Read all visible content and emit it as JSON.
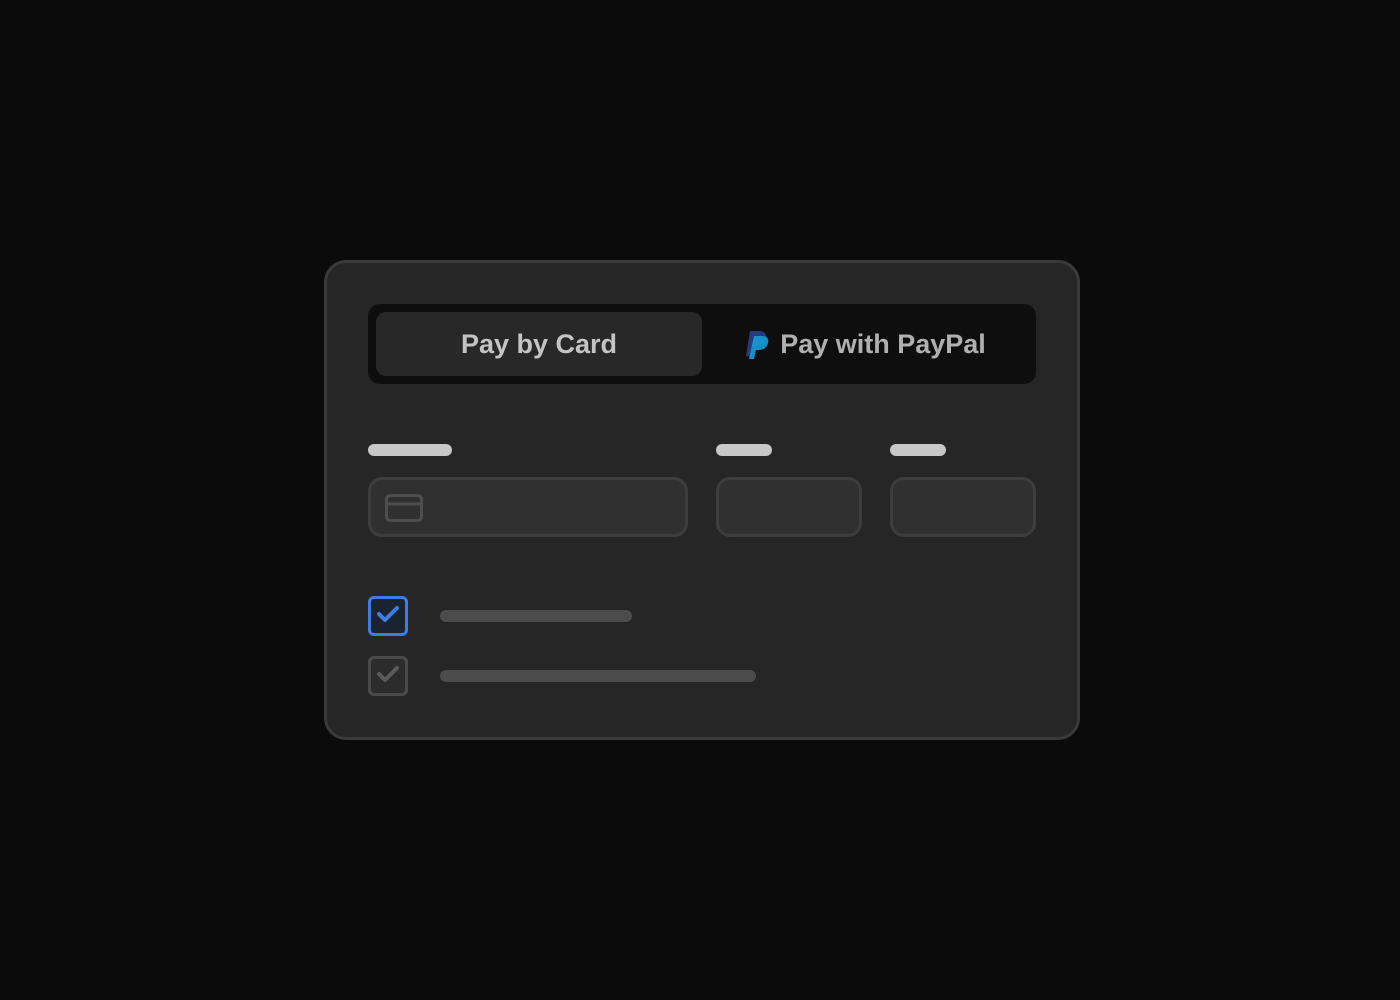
{
  "payment_tabs": {
    "card_label": "Pay by Card",
    "paypal_label": "Pay with PayPal",
    "selected": "card"
  },
  "form": {
    "card_number": {
      "value": "",
      "icon": "credit-card-icon"
    },
    "expiry": {
      "value": ""
    },
    "cvc": {
      "value": ""
    }
  },
  "options": [
    {
      "checked": true,
      "style": "primary"
    },
    {
      "checked": true,
      "style": "muted"
    }
  ],
  "colors": {
    "background": "#0b0b0b",
    "card": "#262626",
    "accent": "#3f7ee0",
    "paypal_dark": "#253b80",
    "paypal_light": "#179bd7"
  }
}
